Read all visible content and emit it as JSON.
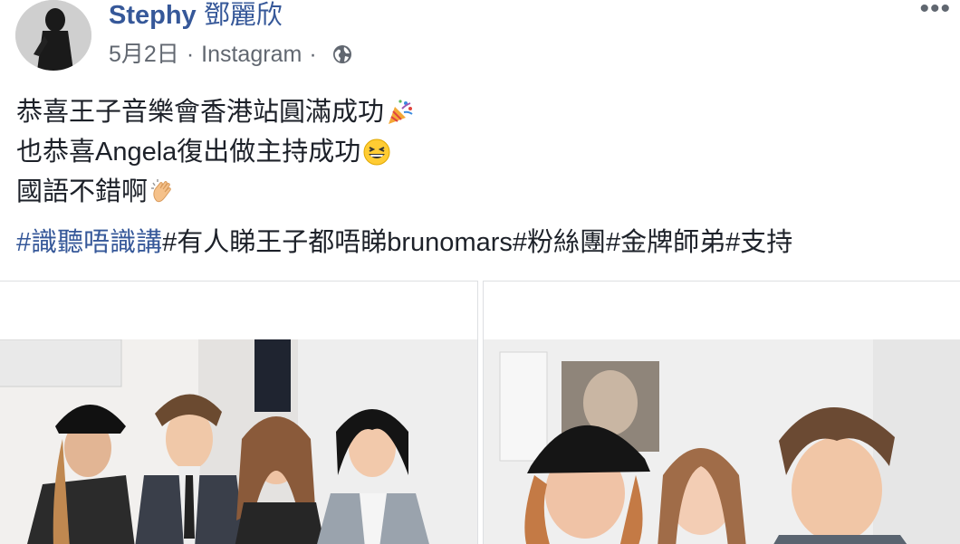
{
  "post": {
    "author": "Stephy",
    "author_cjk": "鄧麗欣",
    "date": "5月2日",
    "separator": "·",
    "source": "Instagram",
    "more": "•••",
    "lines": [
      "恭喜王子音樂會香港站圓滿成功",
      "也恭喜Angela復出做主持成功",
      "國語不錯啊"
    ],
    "tag_link": "#識聽唔識講",
    "tags_rest": "#有人睇王子都唔睇brunomars#粉絲團#金牌師弟#支持"
  },
  "icons": {
    "avatar": "profile-avatar",
    "globe": "globe-icon",
    "more": "more-options-icon",
    "emojis": [
      "party-popper-icon",
      "grinning-face-icon",
      "clapping-hands-icon"
    ]
  },
  "colors": {
    "link": "#365899",
    "text": "#1d2129",
    "meta": "#616770"
  }
}
